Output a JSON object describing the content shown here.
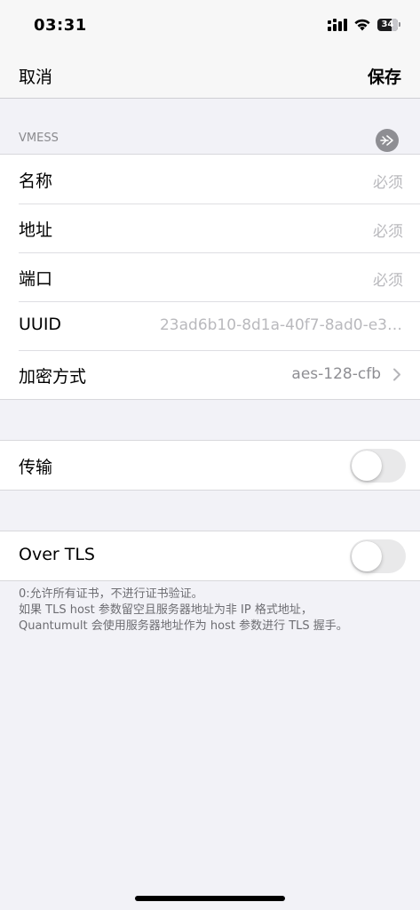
{
  "status_bar": {
    "time": "03:31",
    "battery_level": "34",
    "icons": [
      "cellular-signal-icon",
      "wifi-icon",
      "battery-icon"
    ]
  },
  "nav": {
    "cancel_label": "取消",
    "save_label": "保存"
  },
  "section": {
    "header": "VMESS",
    "header_icon": "share-icon"
  },
  "fields": {
    "name": {
      "label": "名称",
      "placeholder": "必须"
    },
    "address": {
      "label": "地址",
      "placeholder": "必须"
    },
    "port": {
      "label": "端口",
      "placeholder": "必须"
    },
    "uuid": {
      "label": "UUID",
      "value": "23ad6b10-8d1a-40f7-8ad0-e3…"
    },
    "cipher": {
      "label": "加密方式",
      "value": "aes-128-cfb",
      "icon": "chevron-right-icon"
    }
  },
  "transport": {
    "label": "传输",
    "enabled": false
  },
  "tls": {
    "label": "Over TLS",
    "enabled": false
  },
  "footer": {
    "line1": "0:允许所有证书，不进行证书验证。",
    "line2": "如果 TLS host 参数留空且服务器地址为非 IP 格式地址，",
    "line3": "Quantumult 会使用服务器地址作为 host 参数进行 TLS 握手。"
  },
  "colors": {
    "background": "#f2f2f7",
    "cell": "#ffffff",
    "placeholder": "#b9b9bd",
    "secondary": "#8e8e93",
    "toggle_off": "#e9e9ea"
  }
}
